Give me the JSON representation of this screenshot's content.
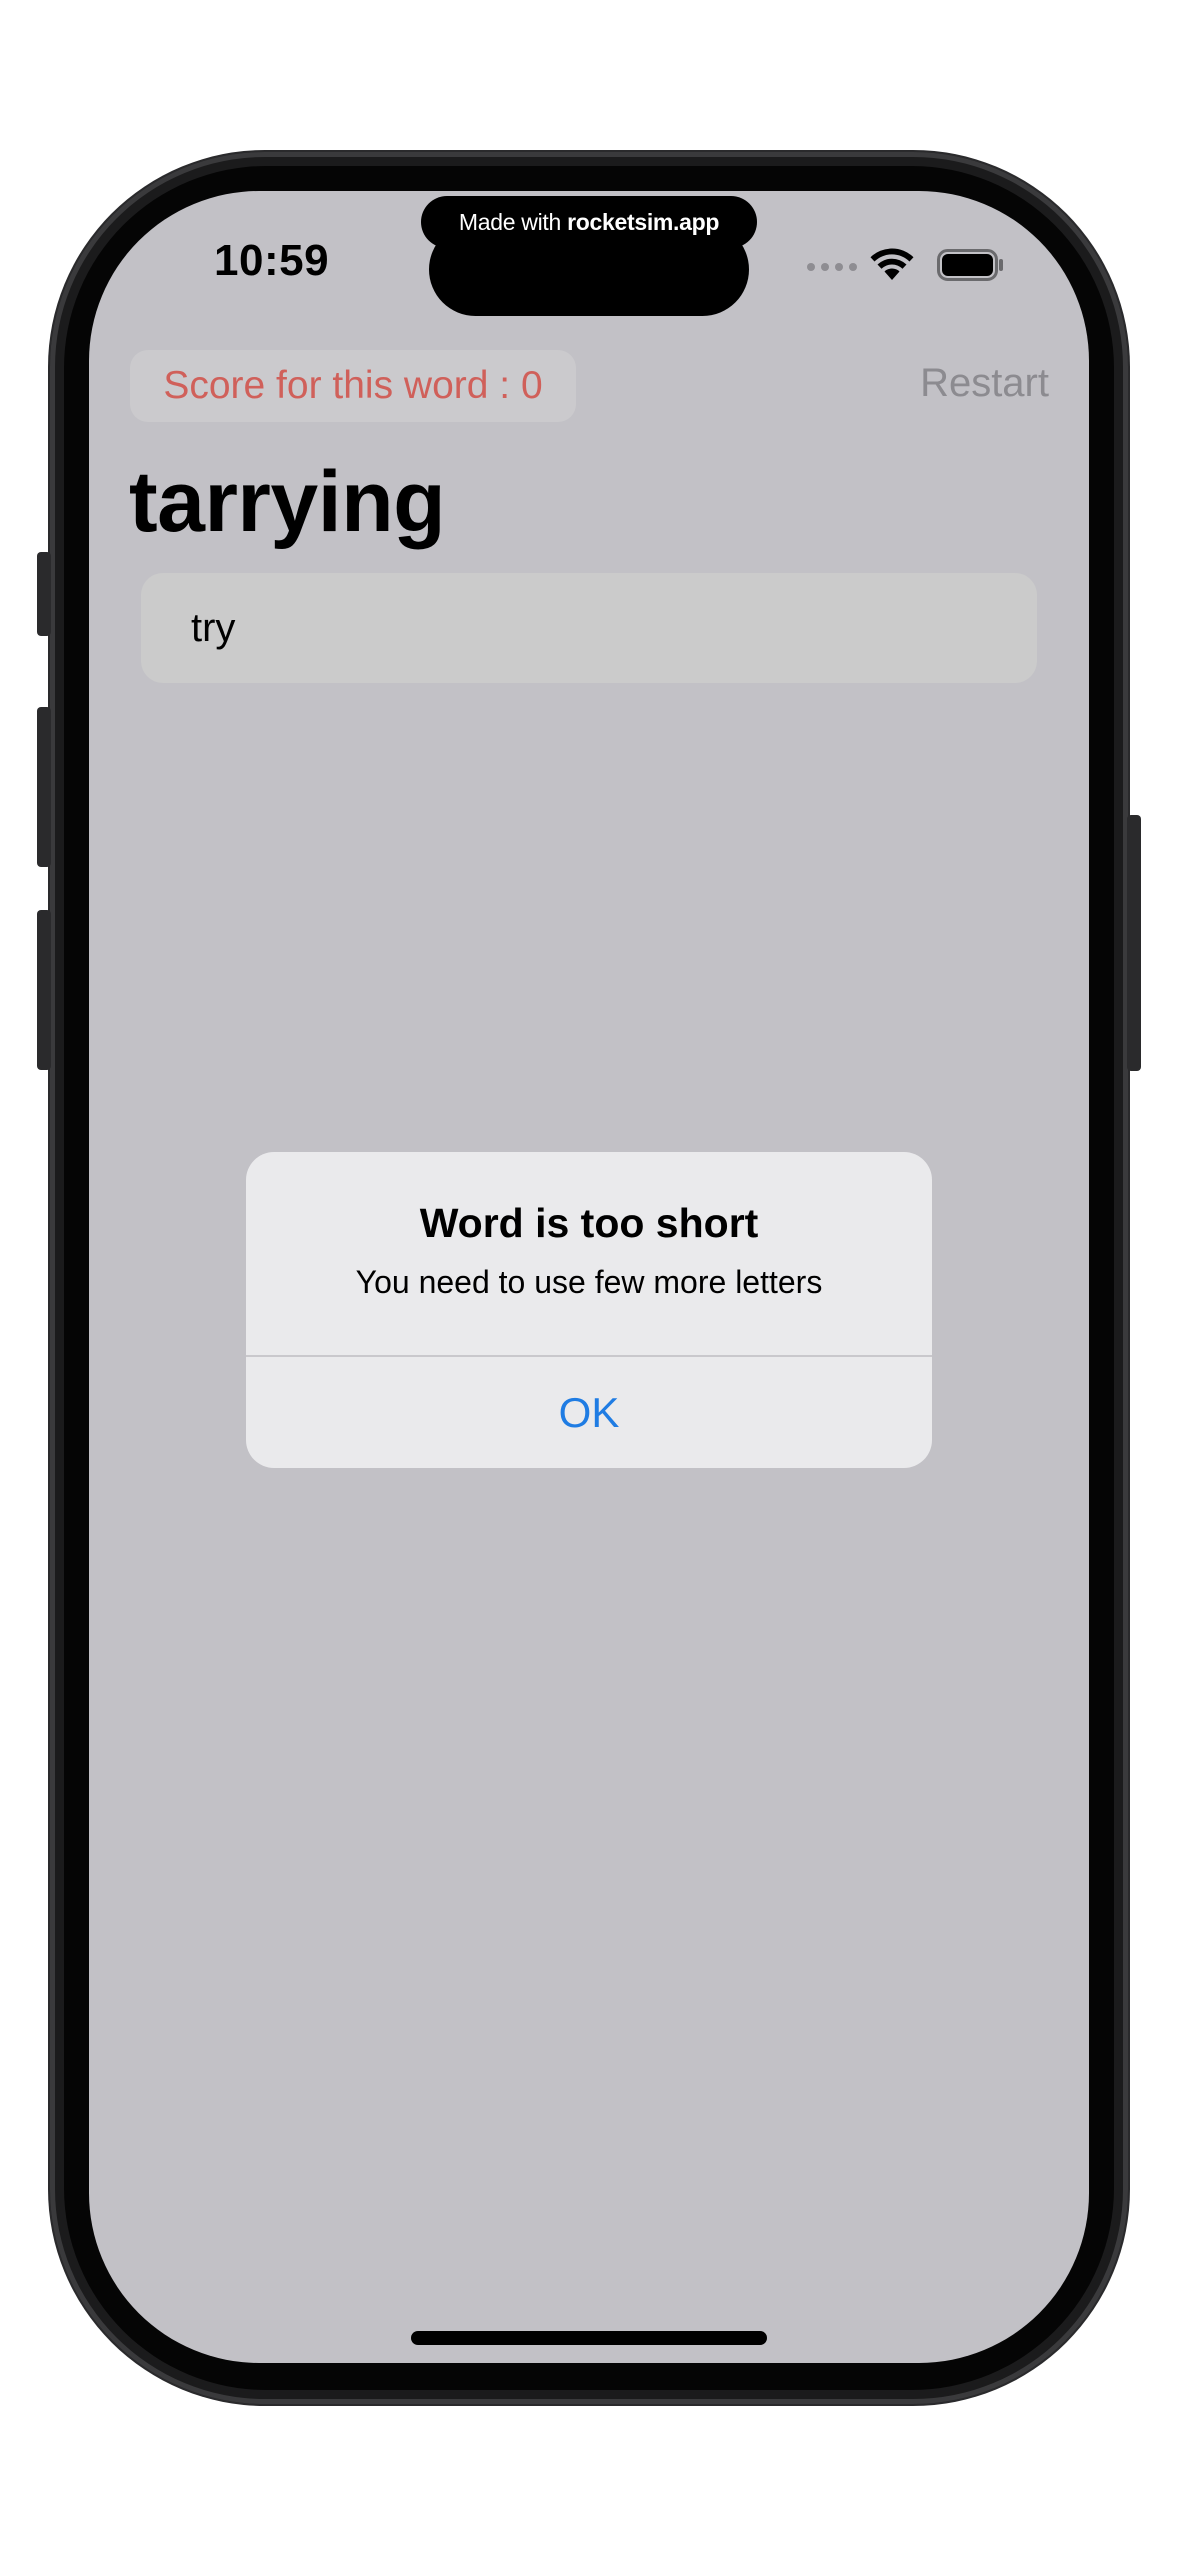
{
  "banner": {
    "prefix": "Made with",
    "brand": "rocketsim.app"
  },
  "status_bar": {
    "time": "10:59",
    "icons": [
      "signal-dots-icon",
      "wifi-icon",
      "battery-icon"
    ]
  },
  "header": {
    "score_label": "Score for this word : 0",
    "restart_label": "Restart"
  },
  "main": {
    "root_word": "tarrying",
    "guess_value": "try"
  },
  "alert": {
    "title": "Word is too short",
    "message": "You need to use few more letters",
    "ok_label": "OK"
  },
  "colors": {
    "screen_background": "#c2c1c6",
    "score_text": "#d0605a",
    "restart_text": "#8c8b90",
    "alert_button": "#1f7ce3"
  }
}
